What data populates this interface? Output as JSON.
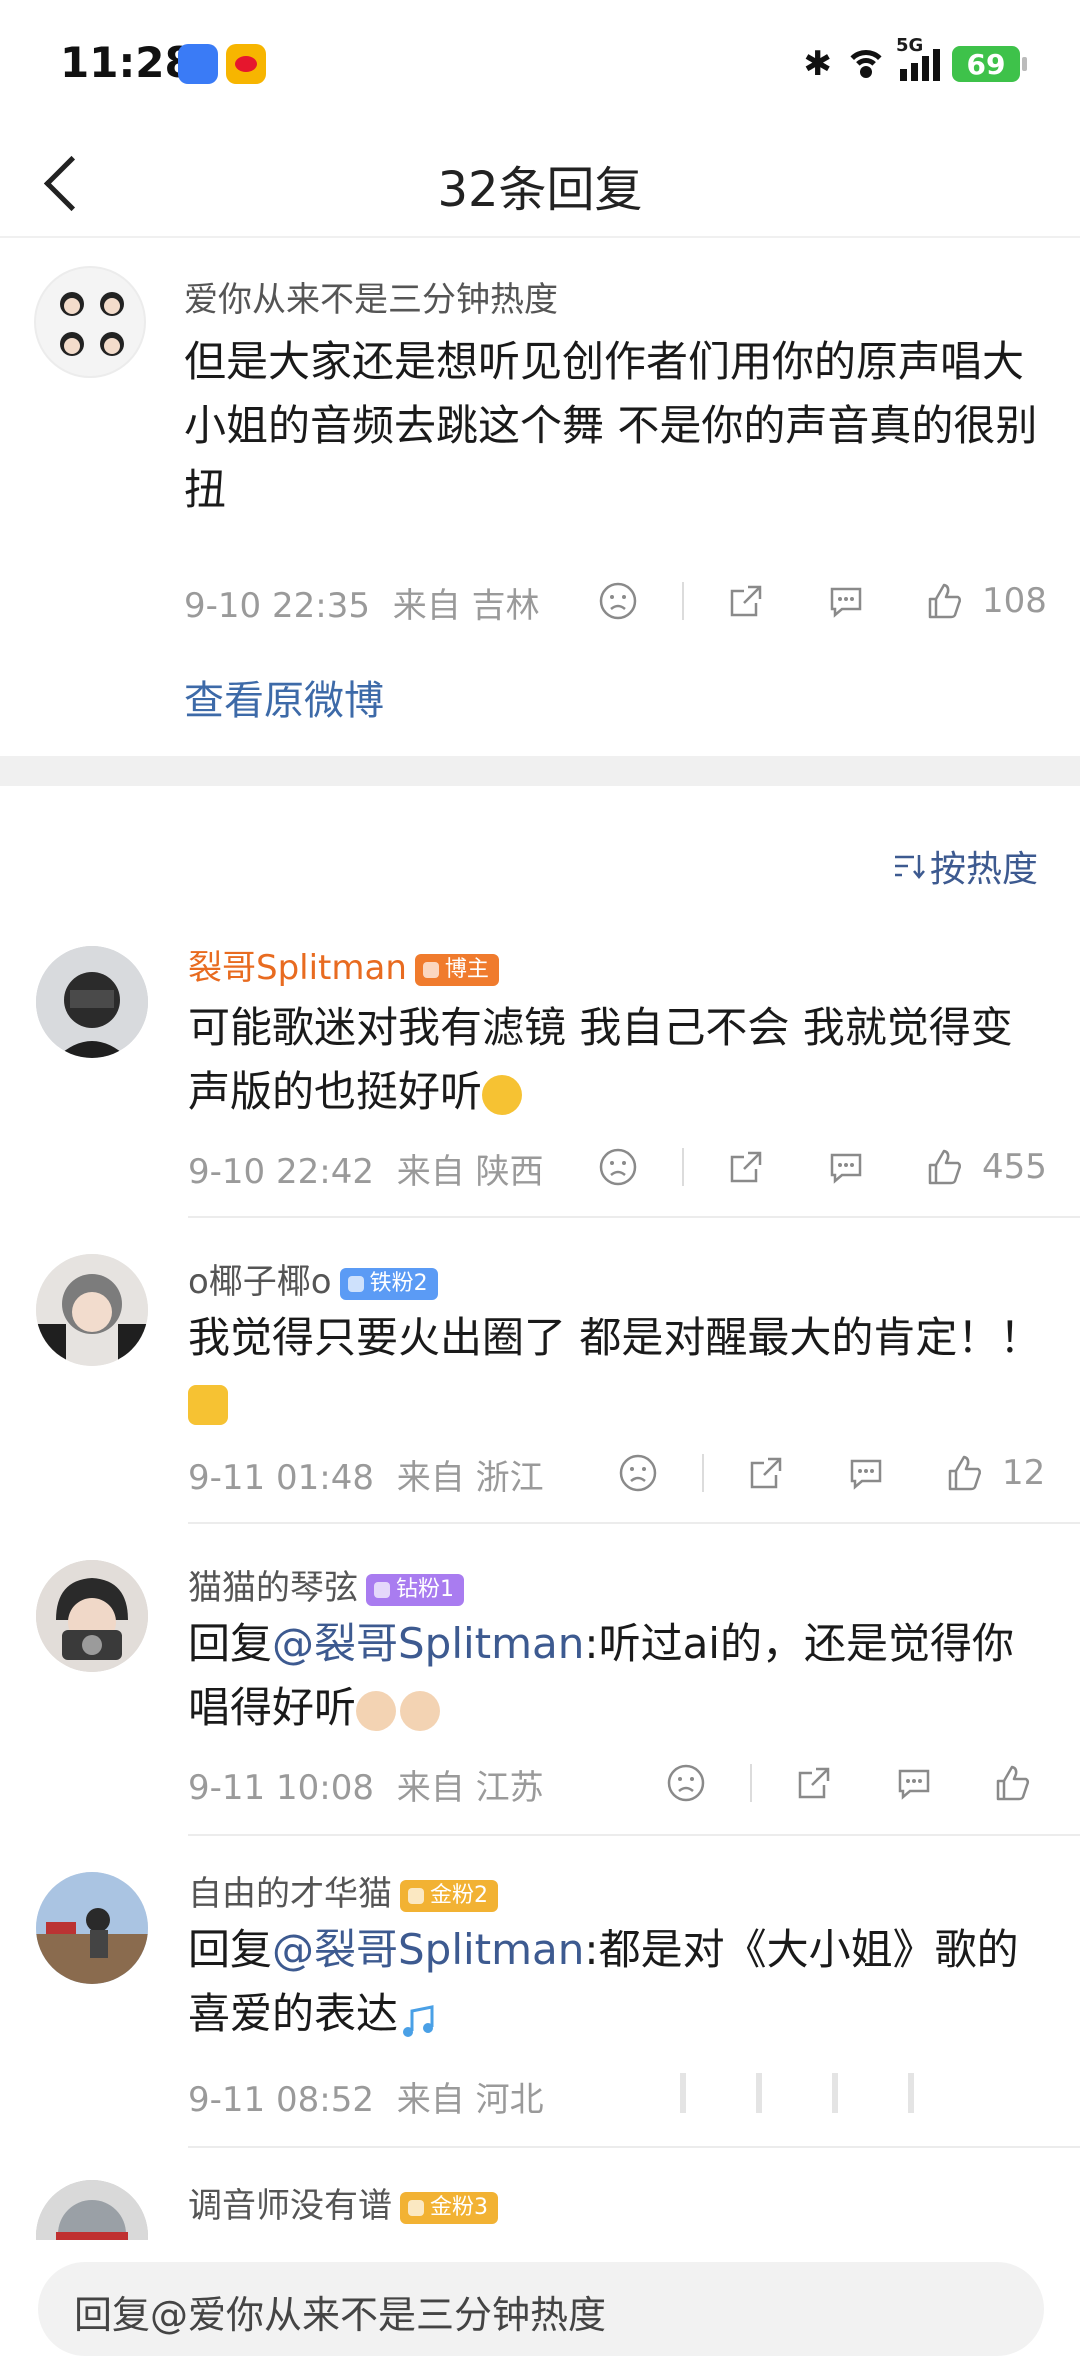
{
  "status": {
    "time": "11:28",
    "network": "5G",
    "battery": "69"
  },
  "nav": {
    "title": "32条回复"
  },
  "main_comment": {
    "user": "爱你从来不是三分钟热度",
    "text": "但是大家还是想听见创作者们用你的原声唱大小姐的音频去跳这个舞 不是你的声音真的很别扭",
    "time": "9-10 22:35",
    "from": "来自 吉林",
    "likes": "108",
    "view_original": "查看原微博"
  },
  "sort": {
    "label": "按热度"
  },
  "replies": [
    {
      "user": "裂哥Splitman",
      "badge": "博主",
      "badge_color": "#f07b2d",
      "prefix": "",
      "mention": "",
      "text": "可能歌迷对我有滤镜 我自己不会 我就觉得变声版的也挺好听",
      "time": "9-10 22:42",
      "from": "来自 陕西",
      "likes": "455"
    },
    {
      "user": "o椰子椰o",
      "badge": "铁粉2",
      "badge_color": "#5b9bf5",
      "prefix": "",
      "mention": "",
      "text": "我觉得只要火出圈了 都是对醒最大的肯定！！",
      "time": "9-11 01:48",
      "from": "来自 浙江",
      "likes": "12"
    },
    {
      "user": "猫猫的琴弦",
      "badge": "钻粉1",
      "badge_color": "#a97cf0",
      "prefix": "回复",
      "mention": "@裂哥Splitman",
      "text": ":听过ai的，还是觉得你唱得好听",
      "time": "9-11 10:08",
      "from": "来自 江苏",
      "likes": ""
    },
    {
      "user": "自由的才华猫",
      "badge": "金粉2",
      "badge_color": "#f2b233",
      "prefix": "回复",
      "mention": "@裂哥Splitman",
      "text": ":都是对《大小姐》歌的喜爱的表达",
      "time": "9-11 08:52",
      "from": "来自 河北",
      "likes": ""
    },
    {
      "user": "调音师没有谱",
      "badge": "金粉3",
      "badge_color": "#f2b233",
      "prefix": "",
      "mention": "",
      "text": "",
      "time": "",
      "from": "",
      "likes": ""
    }
  ],
  "input": {
    "placeholder": "回复@爱你从来不是三分钟热度"
  }
}
